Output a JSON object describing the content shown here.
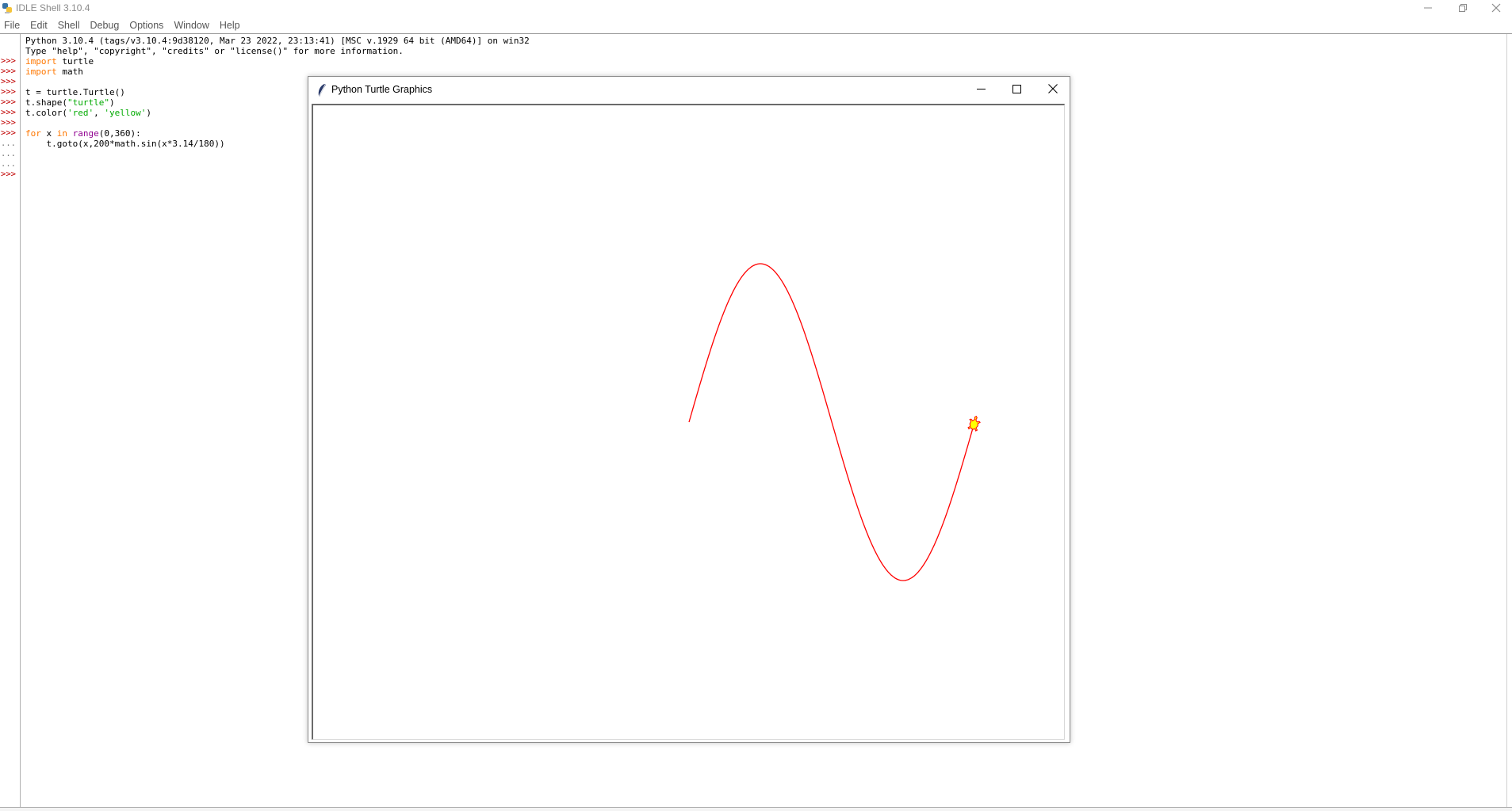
{
  "window": {
    "title": "IDLE Shell 3.10.4",
    "controls": [
      "minimize",
      "restore",
      "close"
    ]
  },
  "menu": {
    "items": [
      {
        "label": "File"
      },
      {
        "label": "Edit"
      },
      {
        "label": "Shell"
      },
      {
        "label": "Debug"
      },
      {
        "label": "Options"
      },
      {
        "label": "Window"
      },
      {
        "label": "Help"
      }
    ]
  },
  "shell": {
    "banner_line1": "Python 3.10.4 (tags/v3.10.4:9d38120, Mar 23 2022, 23:13:41) [MSC v.1929 64 bit (AMD64)] on win32",
    "banner_line2": "Type \"help\", \"copyright\", \"credits\" or \"license()\" for more information.",
    "prompt": ">>>",
    "continuation": "...",
    "lines": {
      "l1_kw": "import",
      "l1_rest": " turtle",
      "l2_kw": "import",
      "l2_rest": " math",
      "l4": "t = turtle.Turtle()",
      "l5_pre": "t.shape(",
      "l5_str": "\"turtle\"",
      "l5_post": ")",
      "l6_pre": "t.color(",
      "l6_str1": "'red'",
      "l6_mid": ", ",
      "l6_str2": "'yellow'",
      "l6_post": ")",
      "l8_kw1": "for",
      "l8_a": " x ",
      "l8_kw2": "in",
      "l8_b": " ",
      "l8_builtin": "range",
      "l8_c": "(0,360):",
      "l9": "    t.goto(x,200*math.sin(x*3.14/180))"
    }
  },
  "turtle_window": {
    "title": "Python Turtle Graphics",
    "controls": [
      "minimize",
      "maximize",
      "close"
    ],
    "pen_color": "#ff0000",
    "fill_color": "#ffff00",
    "turtle_shape": "turtle",
    "plot": {
      "function": "y = 200*sin(x*3.14/180)",
      "x_range": [
        0,
        359
      ],
      "amplitude": 200
    }
  },
  "colors": {
    "prompt": "#c00000",
    "keyword": "#ff7700",
    "string": "#00aa00",
    "builtin": "#900090"
  }
}
